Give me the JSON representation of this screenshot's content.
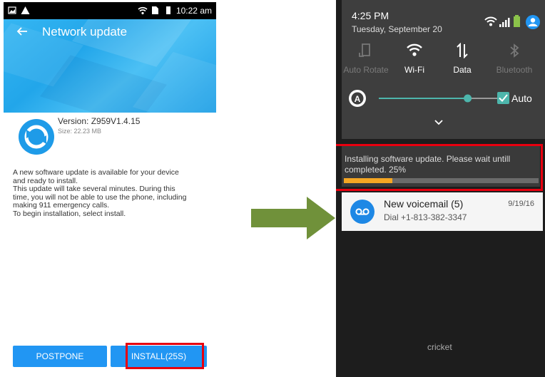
{
  "left_screen": {
    "status_bar": {
      "time": "10:22 am"
    },
    "header": {
      "back_icon": "arrow-left-icon",
      "title": "Network update"
    },
    "update_info": {
      "icon": "sync-icon",
      "version": "Version: Z959V1.4.15",
      "size": "Size: 22.23 MB"
    },
    "description_lines": [
      "A new software update is available for your device",
      "and ready to install.",
      "This update will take several minutes. During this",
      "time, you will not be able to use the phone, including",
      "making 911 emergency calls.",
      "To begin installation, select install."
    ],
    "buttons": {
      "postpone": "POSTPONE",
      "install": "INSTALL(25S)"
    }
  },
  "right_screen": {
    "status": {
      "time": "4:25 PM",
      "date": "Tuesday, September 20"
    },
    "quick_settings": [
      {
        "label": "Auto Rotate",
        "icon": "auto-rotate-icon",
        "active": false
      },
      {
        "label": "Wi-Fi",
        "icon": "wifi-icon",
        "active": true
      },
      {
        "label": "Data",
        "icon": "data-transfer-icon",
        "active": true
      },
      {
        "label": "Bluetooth",
        "icon": "bluetooth-icon",
        "active": false
      }
    ],
    "brightness": {
      "level": 0.7,
      "auto_label": "Auto",
      "auto_checked": true
    },
    "update_notification": {
      "text": "Installing software update. Please wait untill completed.  25%",
      "progress": 0.25
    },
    "voicemail_notification": {
      "title": "New voicemail (5)",
      "subtitle": "Dial +1-813-382-3347",
      "date": "9/19/16"
    },
    "carrier": "cricket"
  },
  "colors": {
    "accent_blue": "#2196f3",
    "highlight_red": "#e8000f",
    "progress_orange": "#f5a623",
    "arrow_green": "#70913a",
    "toggle_teal": "#4db6ac"
  }
}
